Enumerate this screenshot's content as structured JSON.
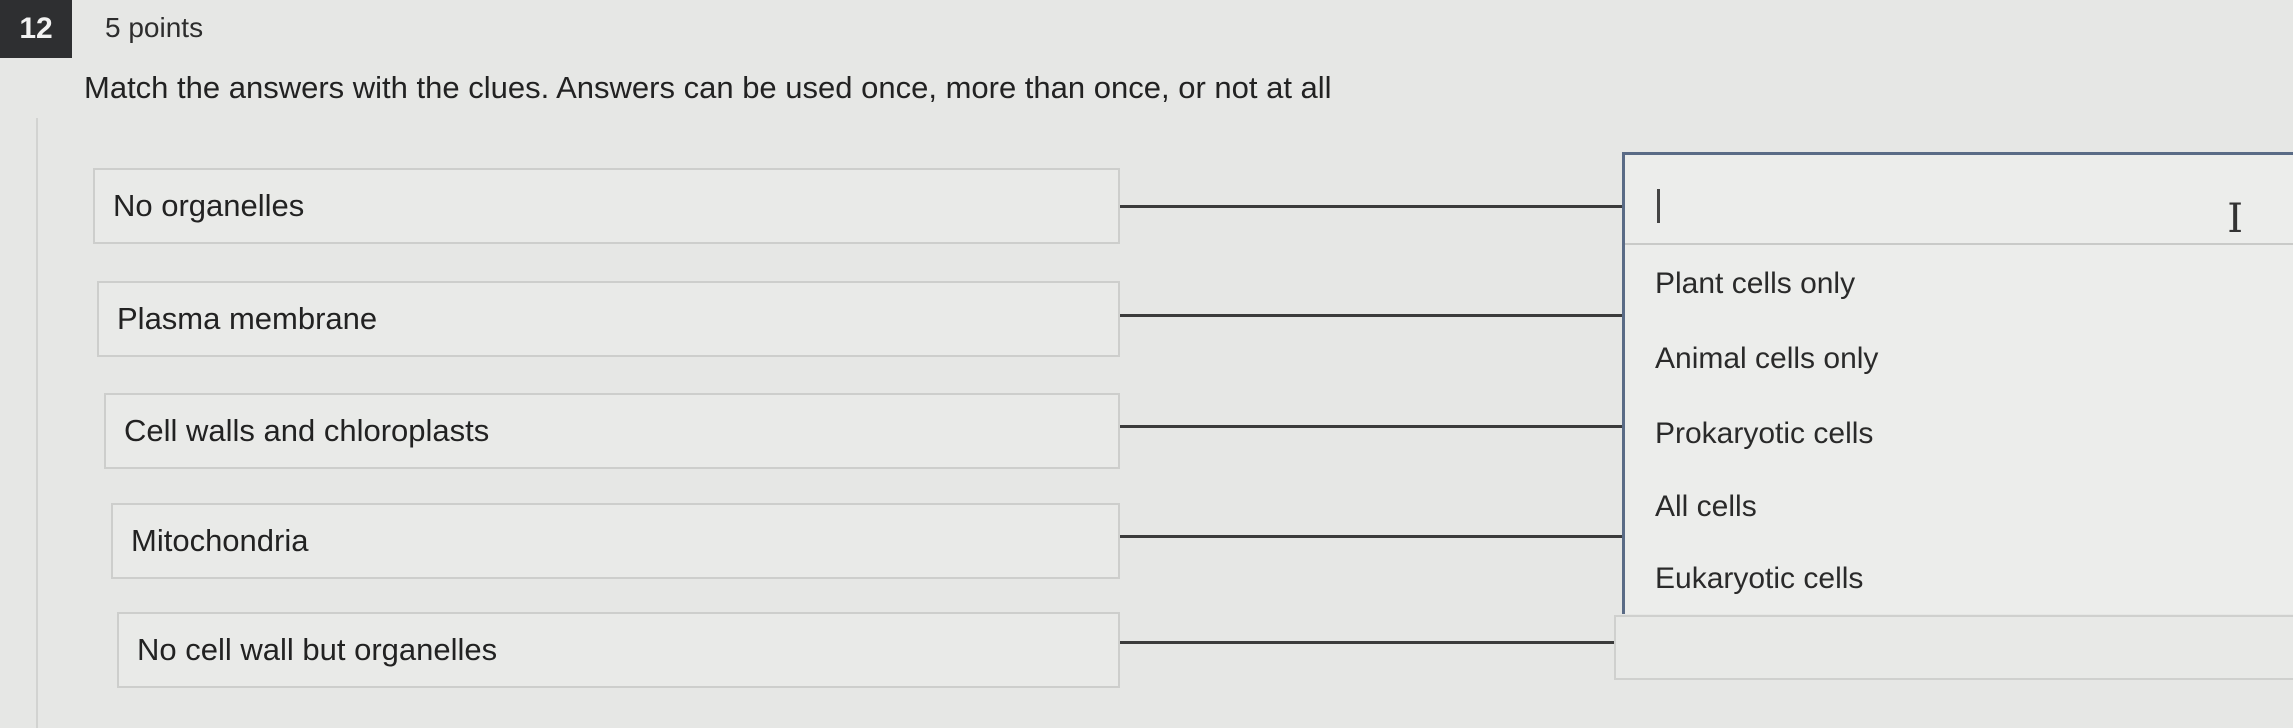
{
  "question": {
    "number": "12",
    "points": "5 points",
    "instructions": "Match the answers with the clues. Answers can be used once, more than once, or not at all"
  },
  "clues": [
    {
      "label": "No organelles"
    },
    {
      "label": "Plasma membrane"
    },
    {
      "label": "Cell walls and chloroplasts"
    },
    {
      "label": "Mitochondria"
    },
    {
      "label": "No cell wall but organelles"
    }
  ],
  "dropdown": {
    "input_value": "",
    "cursor_icon": "text-cursor-icon",
    "options": [
      {
        "label": "Plant cells only"
      },
      {
        "label": "Animal cells only"
      },
      {
        "label": "Prokaryotic cells"
      },
      {
        "label": "All cells"
      },
      {
        "label": "Eukaryotic cells"
      }
    ]
  }
}
